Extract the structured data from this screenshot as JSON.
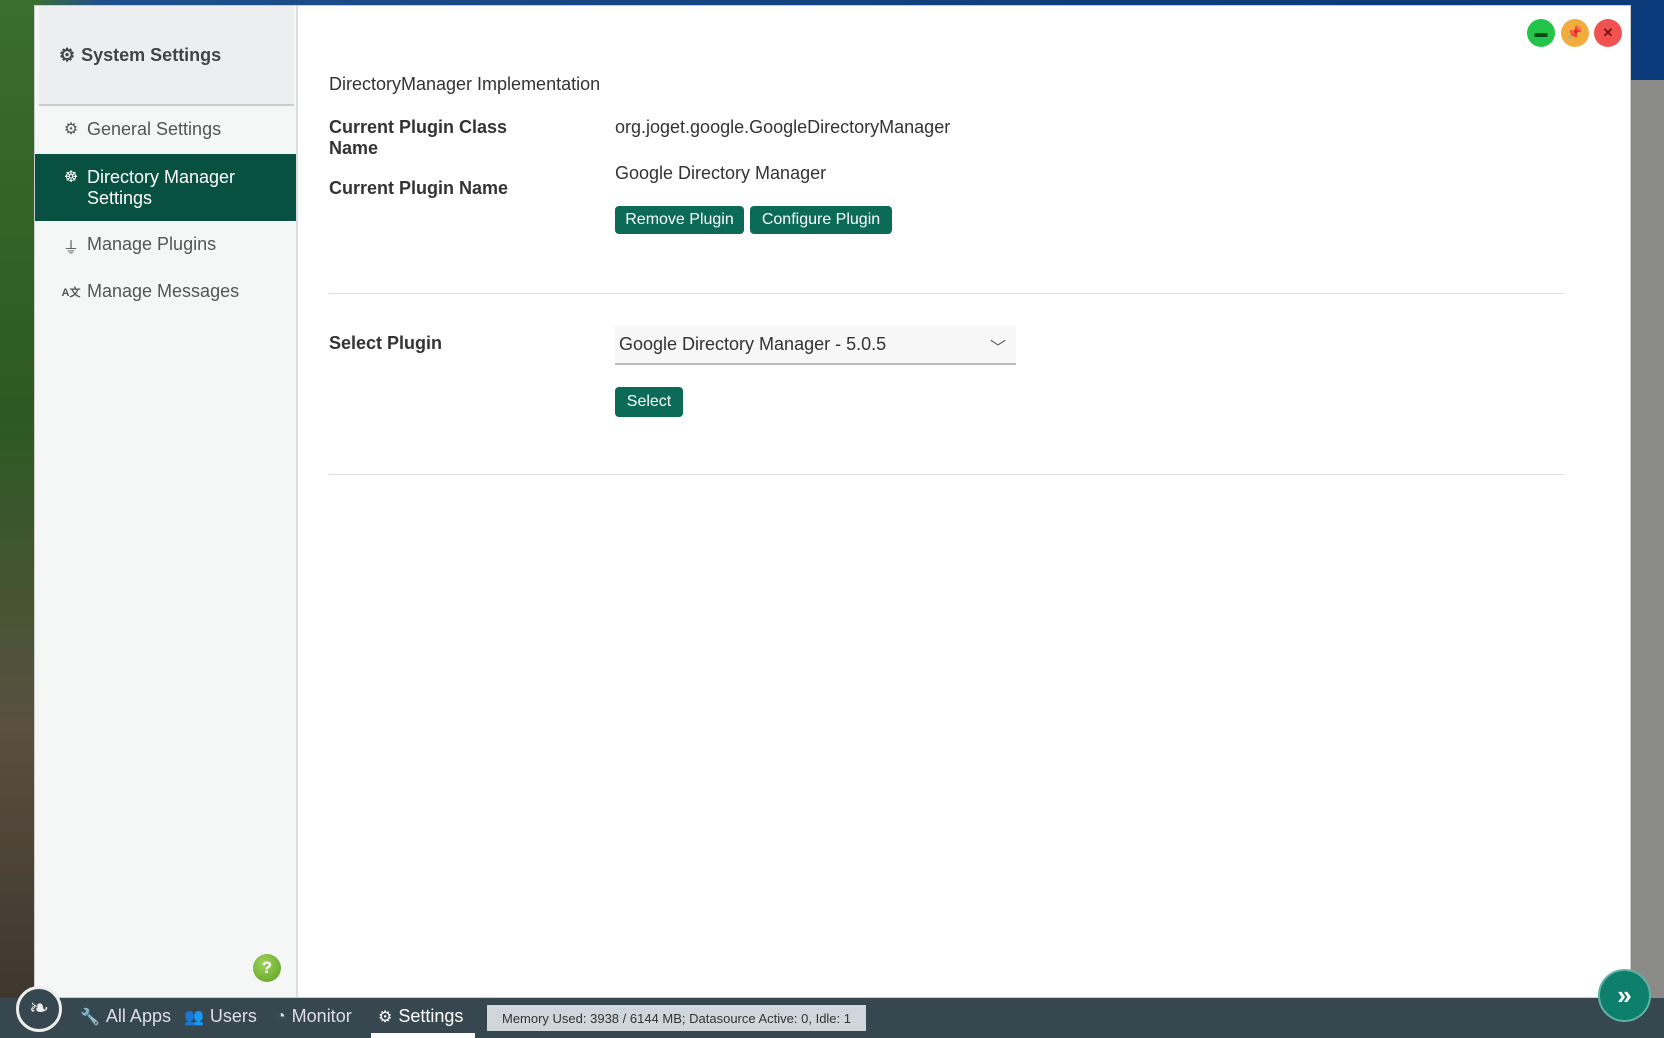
{
  "sidebar": {
    "title": "System Settings",
    "items": [
      {
        "label": "General Settings",
        "icon": "gear-icon"
      },
      {
        "label": "Directory Manager Settings",
        "icon": "users-cog-icon",
        "active": true
      },
      {
        "label": "Manage Plugins",
        "icon": "plug-icon"
      },
      {
        "label": "Manage Messages",
        "icon": "language-icon"
      }
    ]
  },
  "main": {
    "section_title": "DirectoryManager Implementation",
    "class_name_label": "Current Plugin Class Name",
    "class_name_value": "org.joget.google.GoogleDirectoryManager",
    "plugin_name_label": "Current Plugin Name",
    "plugin_name_value": "Google Directory Manager",
    "remove_button": "Remove Plugin",
    "configure_button": "Configure Plugin",
    "select_plugin_label": "Select Plugin",
    "select_plugin_value": "Google Directory Manager - 5.0.5",
    "select_button": "Select"
  },
  "window_controls": {
    "colors": {
      "maximize": "#22c44a",
      "pin": "#f0ad3e",
      "close": "#f05252"
    }
  },
  "taskbar": {
    "items": [
      {
        "label": "All Apps"
      },
      {
        "label": "Users"
      },
      {
        "label": "Monitor"
      },
      {
        "label": "Settings",
        "active": true
      }
    ],
    "status": "Memory Used: 3938 / 6144 MB; Datasource Active: 0, Idle: 1"
  },
  "accent": "#075042"
}
